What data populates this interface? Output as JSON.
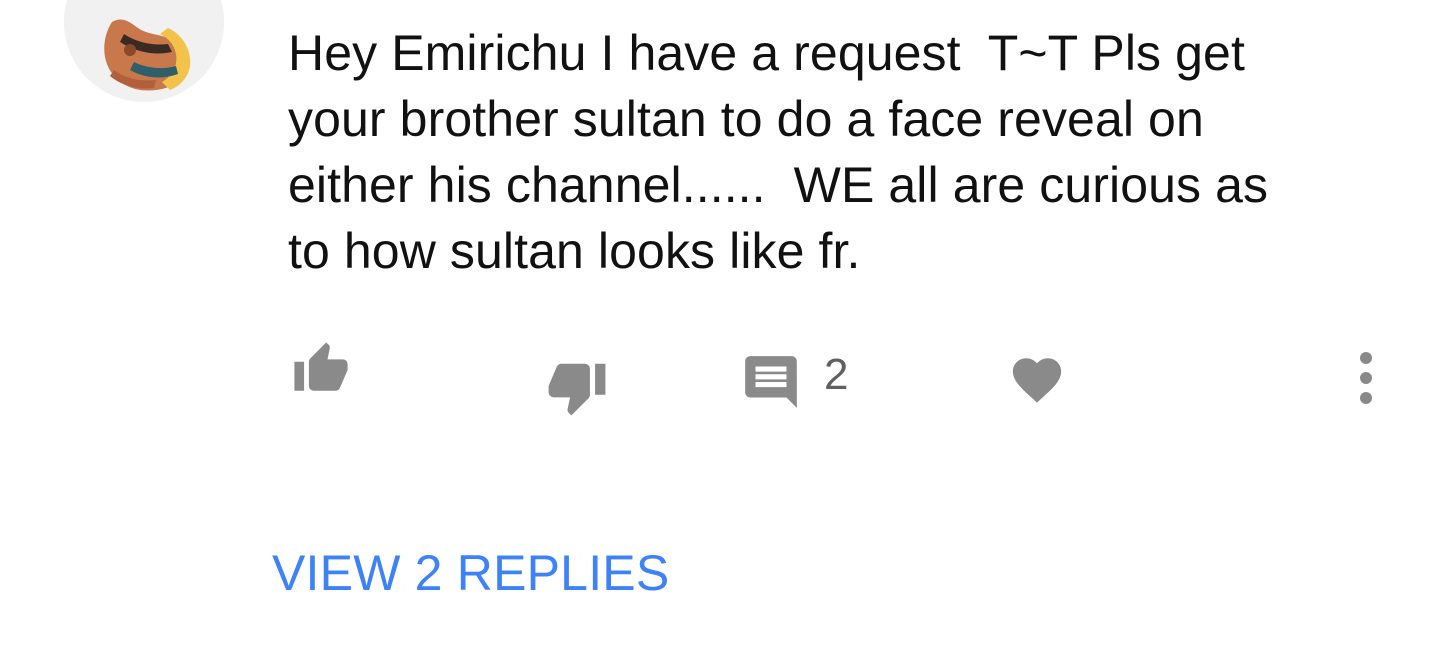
{
  "comment": {
    "text": "Hey Emirichu I have a request  T~T Pls get\nyour brother sultan to do a face reveal on\neither his channel......  WE all are curious as\nto how sultan looks like fr."
  },
  "actions": {
    "reply_count": "2",
    "icon_color": "#8a8a8a",
    "icons": [
      "thumbs-up-icon",
      "thumbs-down-icon",
      "comment-icon",
      "heart-icon",
      "more-vertical-icon"
    ]
  },
  "replies": {
    "label": "VIEW 2 REPLIES",
    "color": "#3e82f7"
  }
}
